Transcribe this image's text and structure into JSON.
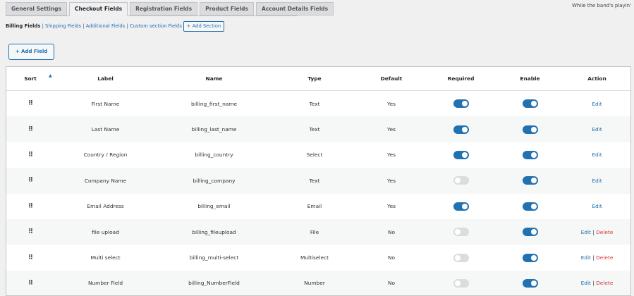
{
  "top_note": "While the band's playin'",
  "tabs": [
    {
      "label": "General Settings",
      "active": false
    },
    {
      "label": "Checkout Fields",
      "active": true
    },
    {
      "label": "Registration Fields",
      "active": false
    },
    {
      "label": "Product Fields",
      "active": false
    },
    {
      "label": "Account Details Fields",
      "active": false
    }
  ],
  "subnav": {
    "current": "Billing Fields",
    "links": [
      "Shipping Fields",
      "Additional Fields",
      "Custom section Fields"
    ],
    "add_section": "+ Add Section"
  },
  "add_field": "+ Add Field",
  "colors": {
    "accent": "#2271b1",
    "delete": "#d63638",
    "toggle_off": "#dcdcde"
  },
  "table": {
    "headers": {
      "sort": "Sort",
      "label": "Label",
      "name": "Name",
      "type": "Type",
      "default": "Default",
      "required": "Required",
      "enable": "Enable",
      "action": "Action"
    },
    "rows": [
      {
        "label": "First Name",
        "name": "billing_first_name",
        "type": "Text",
        "default": "Yes",
        "required": true,
        "enable": true,
        "actions": [
          "Edit"
        ]
      },
      {
        "label": "Last Name",
        "name": "billing_last_name",
        "type": "Text",
        "default": "Yes",
        "required": true,
        "enable": true,
        "actions": [
          "Edit"
        ]
      },
      {
        "label": "Country / Region",
        "name": "billing_country",
        "type": "Select",
        "default": "Yes",
        "required": true,
        "enable": true,
        "actions": [
          "Edit"
        ]
      },
      {
        "label": "Company Name",
        "name": "billing_company",
        "type": "Text",
        "default": "Yes",
        "required": false,
        "enable": true,
        "actions": [
          "Edit"
        ]
      },
      {
        "label": "Email Address",
        "name": "billing_email",
        "type": "Email",
        "default": "Yes",
        "required": true,
        "enable": true,
        "actions": [
          "Edit"
        ]
      },
      {
        "label": "file upload",
        "name": "billing_fileupload",
        "type": "File",
        "default": "No",
        "required": false,
        "enable": true,
        "actions": [
          "Edit",
          "Delete"
        ]
      },
      {
        "label": "Multi select",
        "name": "billing_multi-select",
        "type": "Multiselect",
        "default": "No",
        "required": false,
        "enable": true,
        "actions": [
          "Edit",
          "Delete"
        ]
      },
      {
        "label": "Number Field",
        "name": "billing_NumberField",
        "type": "Number",
        "default": "No",
        "required": false,
        "enable": true,
        "actions": [
          "Edit",
          "Delete"
        ]
      }
    ]
  }
}
